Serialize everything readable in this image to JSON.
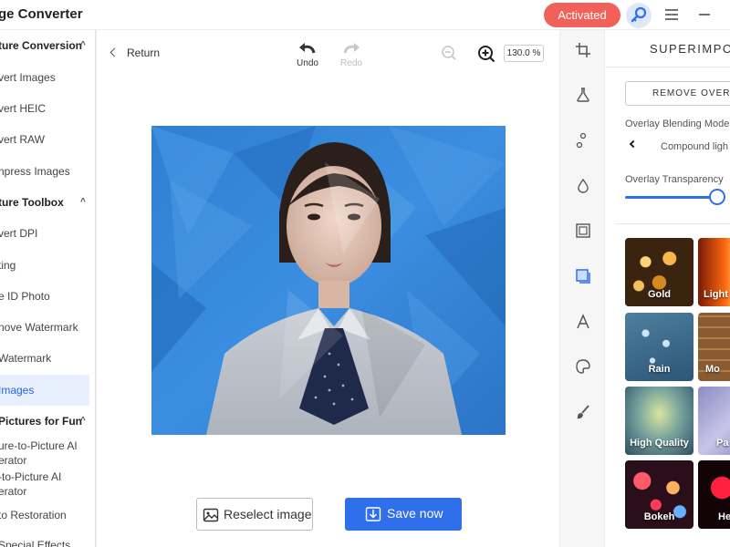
{
  "app": {
    "title": "ge Converter"
  },
  "titlebar": {
    "activated_label": "Activated",
    "key_icon": "key-icon",
    "menu_icon": "hamburger-menu-icon",
    "minimize_icon": "minimize-icon",
    "activated_color": "#f2605a"
  },
  "sidebar": {
    "items": [
      {
        "label": "ture Conversion",
        "section": true,
        "chevron": "^"
      },
      {
        "label": "vert Images"
      },
      {
        "label": "vert HEIC"
      },
      {
        "label": "vert RAW"
      },
      {
        "label": "npress Images"
      },
      {
        "label": "ture Toolbox",
        "section": true,
        "chevron": "^"
      },
      {
        "label": "vert DPI"
      },
      {
        "label": "ting"
      },
      {
        "label": "e ID Photo"
      },
      {
        "label": "nove Watermark"
      },
      {
        "label": " Watermark"
      },
      {
        "label": " Images",
        "active": true
      },
      {
        "label": " Pictures for Fun",
        "section": true,
        "chevron": "^"
      },
      {
        "label": "ure-to-Picture AI",
        "label2": "erator"
      },
      {
        "label": "-to-Picture AI",
        "label2": "erator"
      },
      {
        "label": " to Restoration"
      },
      {
        "label": "Special Effects"
      }
    ]
  },
  "main": {
    "return_label": "Return",
    "undo_label": "Undo",
    "redo_label": "Redo",
    "zoom_value": "130.0 %",
    "reselect_label": "Reselect image",
    "save_label": "Save now"
  },
  "toolcol": {
    "icons": [
      "crop-icon",
      "beaker-icon",
      "nodes-icon",
      "drop-icon",
      "frame-icon",
      "superimpose-icon",
      "text-icon",
      "palette-icon",
      "brush-icon"
    ],
    "active_index": 5
  },
  "panel": {
    "title": "SUPERIMPOS",
    "remove_label": "REMOVE OVERLA",
    "blend_label": "Overlay Blending Mode",
    "blend_value": "Compound ligh",
    "transparency_label": "Overlay Transparency",
    "transparency_value": 1.0,
    "thumbnails": [
      {
        "caption": "Gold"
      },
      {
        "caption": "Light"
      },
      {
        "caption": "Rain"
      },
      {
        "caption": "Mo"
      },
      {
        "caption": "High Quality"
      },
      {
        "caption": "Pa"
      },
      {
        "caption": "Bokeh"
      },
      {
        "caption": "He"
      }
    ],
    "accent_color": "#2f6fec"
  }
}
